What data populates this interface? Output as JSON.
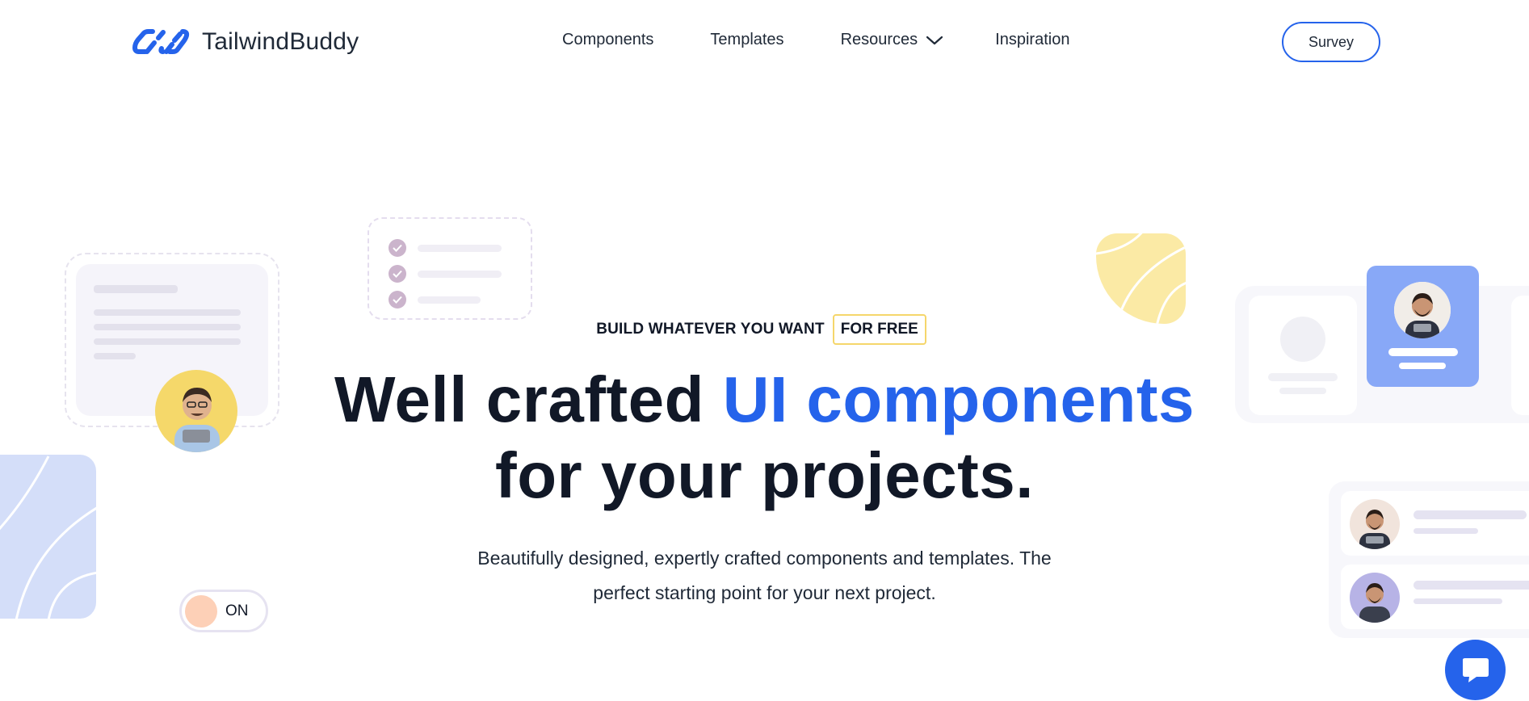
{
  "brand": {
    "name": "TailwindBuddy",
    "accent_color": "#2563eb"
  },
  "nav": {
    "items": [
      {
        "label": "Components"
      },
      {
        "label": "Templates"
      },
      {
        "label": "Resources",
        "has_dropdown": true
      },
      {
        "label": "Inspiration"
      }
    ],
    "survey_label": "Survey"
  },
  "hero": {
    "kicker": "BUILD WHATEVER YOU WANT",
    "kicker_badge": "FOR FREE",
    "headline_part1": "Well crafted ",
    "headline_accent": "UI components",
    "headline_part2": "for your projects.",
    "subtext_line1": "Beautifully designed, expertly crafted components and templates. The",
    "subtext_line2": "perfect starting point for your next project."
  },
  "decorations": {
    "toggle_label": "ON",
    "toggle_state": "on"
  },
  "icons": {
    "logo": "infinity-link-logo-icon",
    "dropdown": "chevron-down-icon",
    "chat": "chat-bubble-icon"
  }
}
